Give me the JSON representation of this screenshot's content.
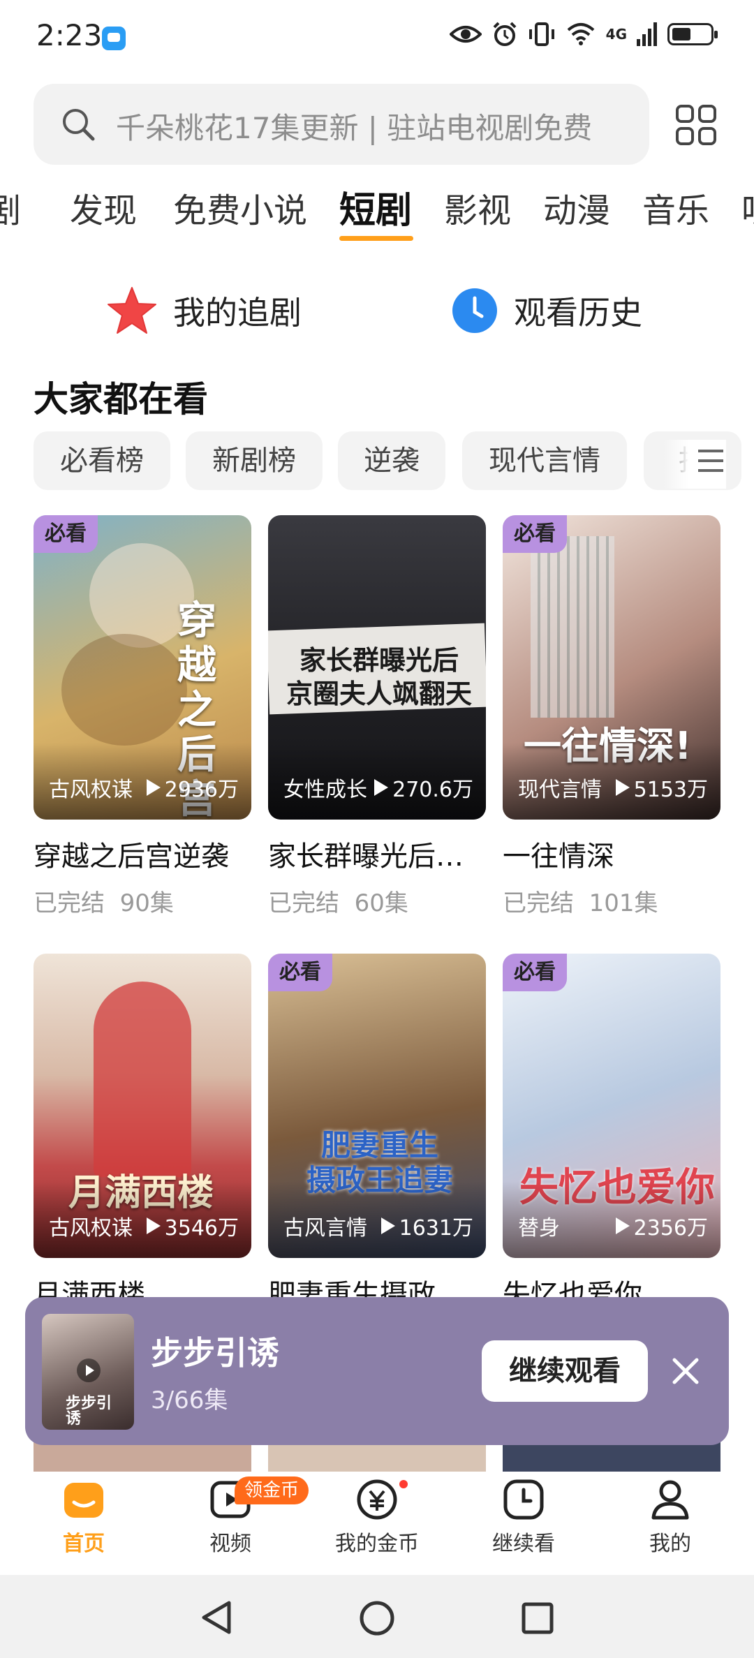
{
  "status_bar": {
    "time": "2:23",
    "network": "4G"
  },
  "search": {
    "placeholder": "千朵桃花17集更新 | 驻站电视剧免费"
  },
  "tabs": [
    "剧",
    "发现",
    "免费小说",
    "短剧",
    "影视",
    "动漫",
    "音乐",
    "听"
  ],
  "active_tab": "短剧",
  "quick_links": {
    "follow": "我的追剧",
    "history": "观看历史"
  },
  "section_title": "大家都在看",
  "chips": [
    "必看榜",
    "新剧榜",
    "逆袭",
    "现代言情",
    "抗"
  ],
  "dramas": [
    {
      "badge": "必看",
      "tag": "古风权谋",
      "views": "2936万",
      "title": "穿越之后宫逆袭",
      "status": "已完结",
      "episodes": "90集",
      "poster_text": "穿越之后宫逆",
      "colors": [
        "#7fb2c8",
        "#d8b46a",
        "#b9874a"
      ]
    },
    {
      "badge": "",
      "tag": "女性成长",
      "views": "270.6万",
      "title": "家长群曝光后…",
      "status": "已完结",
      "episodes": "60集",
      "poster_text": "家长群曝光后\n京圈夫人飒翻天",
      "colors": [
        "#2a2a2e",
        "#4a4a50",
        "#1b1b1f"
      ]
    },
    {
      "badge": "必看",
      "tag": "现代言情",
      "views": "5153万",
      "title": "一往情深",
      "status": "已完结",
      "episodes": "101集",
      "poster_text": "一往情深!",
      "colors": [
        "#e9d8d0",
        "#b58c7f",
        "#3a2a28"
      ]
    },
    {
      "badge": "",
      "tag": "古风权谋",
      "views": "3546万",
      "title": "月满西楼",
      "status": "",
      "episodes": "",
      "poster_text": "月满西楼",
      "colors": [
        "#e9ddd2",
        "#c24a4a",
        "#8a2d2d"
      ]
    },
    {
      "badge": "必看",
      "tag": "古风言情",
      "views": "1631万",
      "title": "肥妻重生摄政",
      "status": "",
      "episodes": "",
      "poster_text": "肥妻重生\n摄政王追妻",
      "colors": [
        "#caa77b",
        "#7b5a3c",
        "#3c4a6a"
      ]
    },
    {
      "badge": "必看",
      "tag": "替身",
      "views": "2356万",
      "title": "失忆也爱你",
      "status": "",
      "episodes": "",
      "poster_text": "失忆也爱你",
      "colors": [
        "#dfe8f3",
        "#b8c9e0",
        "#e8b3b8"
      ]
    }
  ],
  "continue_watching": {
    "title": "步步引诱",
    "progress": "3/66集",
    "button": "继续观看",
    "thumb_text": "步步引诱"
  },
  "bottom_nav": {
    "items": [
      "首页",
      "视频",
      "我的金币",
      "继续看",
      "我的"
    ],
    "active": "首页",
    "coin_badge": "领金币"
  },
  "accent_color": "#ff9f1a"
}
